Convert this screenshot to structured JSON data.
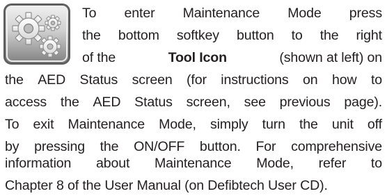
{
  "icon": {
    "name": "tool-icon"
  },
  "paragraph": {
    "line1": "To enter Maintenance Mode press",
    "line2": "the bottom softkey button to the right",
    "line3": {
      "before": "of the",
      "bold": "Tool Icon",
      "after": "(shown at left) on"
    },
    "line4": "the AED Status screen (for instructions on how to",
    "line5": "access the AED Status screen, see previous page).",
    "line6": "To exit Maintenance Mode, simply turn the unit off",
    "line7": "by pressing the ON/OFF button. For comprehensive",
    "line8": "information about Maintenance Mode, refer to",
    "line9": "Chapter 8 of the User Manual (on Defibtech User CD)."
  }
}
